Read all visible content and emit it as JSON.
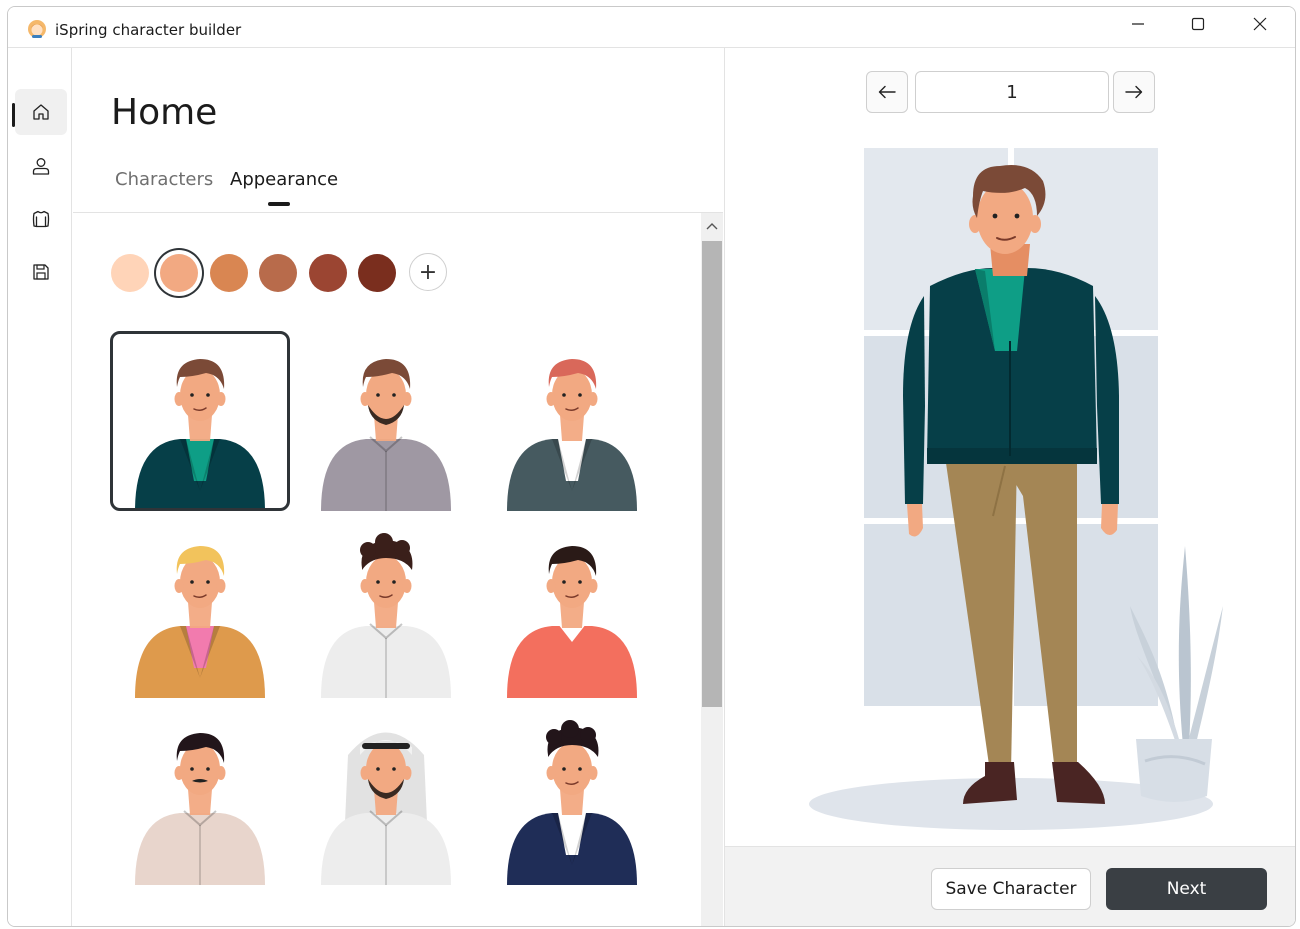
{
  "window": {
    "title": "iSpring character builder",
    "controls": {
      "minimize": "—",
      "maximize": "☐",
      "close": "✕"
    }
  },
  "navrail": {
    "items": [
      {
        "icon": "home-icon",
        "active": true
      },
      {
        "icon": "person-icon",
        "active": false
      },
      {
        "icon": "shirt-icon",
        "active": false
      },
      {
        "icon": "save-icon",
        "active": false
      }
    ]
  },
  "main": {
    "title": "Home",
    "tabs": [
      {
        "label": "Characters",
        "selected": false
      },
      {
        "label": "Appearance",
        "selected": true
      }
    ],
    "skin_tones": [
      "#FFD4B8",
      "#F2A982",
      "#D98652",
      "#B86B4B",
      "#9B4532",
      "#7A2E1E"
    ],
    "selected_skin_tone": 1,
    "add_swatch_label": "+",
    "characters": [
      {
        "hair": "#7B4A37",
        "top": "#063F48",
        "collar": "#0E9E86",
        "style": "cardigan",
        "selected": true
      },
      {
        "hair": "#7B4A37",
        "top": "#9F98A3",
        "collar": "#9F98A3",
        "style": "shirt",
        "beard": true
      },
      {
        "hair": "#D9685A",
        "top": "#465A60",
        "collar": "#FFFFFF",
        "style": "cardigan"
      },
      {
        "hair": "#F2C35C",
        "top": "#DE9A4C",
        "collar": "#F27BAE",
        "style": "cardigan"
      },
      {
        "hair": "#3A1F1A",
        "top": "#EDEDED",
        "collar": "#EDEDED",
        "style": "shirt",
        "curly": true
      },
      {
        "hair": "#2A1A17",
        "top": "#F36F5E",
        "collar": "#FFFFFF",
        "style": "sweater"
      },
      {
        "hair": "#22151A",
        "top": "#E8D5CC",
        "collar": "#E8D5CC",
        "style": "shirt",
        "mustache": true
      },
      {
        "hair": "#EDEDED",
        "top": "#EDEDED",
        "collar": "#EDEDED",
        "style": "keffiyeh",
        "beard": true
      },
      {
        "hair": "#22151A",
        "top": "#1F2D57",
        "collar": "#FFFFFF",
        "style": "blazer",
        "curly": true
      }
    ]
  },
  "preview": {
    "page_value": "1",
    "prev_icon": "arrow-left-icon",
    "next_icon": "arrow-right-icon",
    "colors": {
      "cardigan": "#063F48",
      "collar": "#0E9E86",
      "pants": "#A48655",
      "shoes": "#4A2523",
      "hair": "#7B4A37",
      "skin": "#F2A982",
      "window": "#E3E8EE",
      "floor": "#DFE4EB"
    }
  },
  "footer": {
    "save_label": "Save Character",
    "next_label": "Next"
  }
}
